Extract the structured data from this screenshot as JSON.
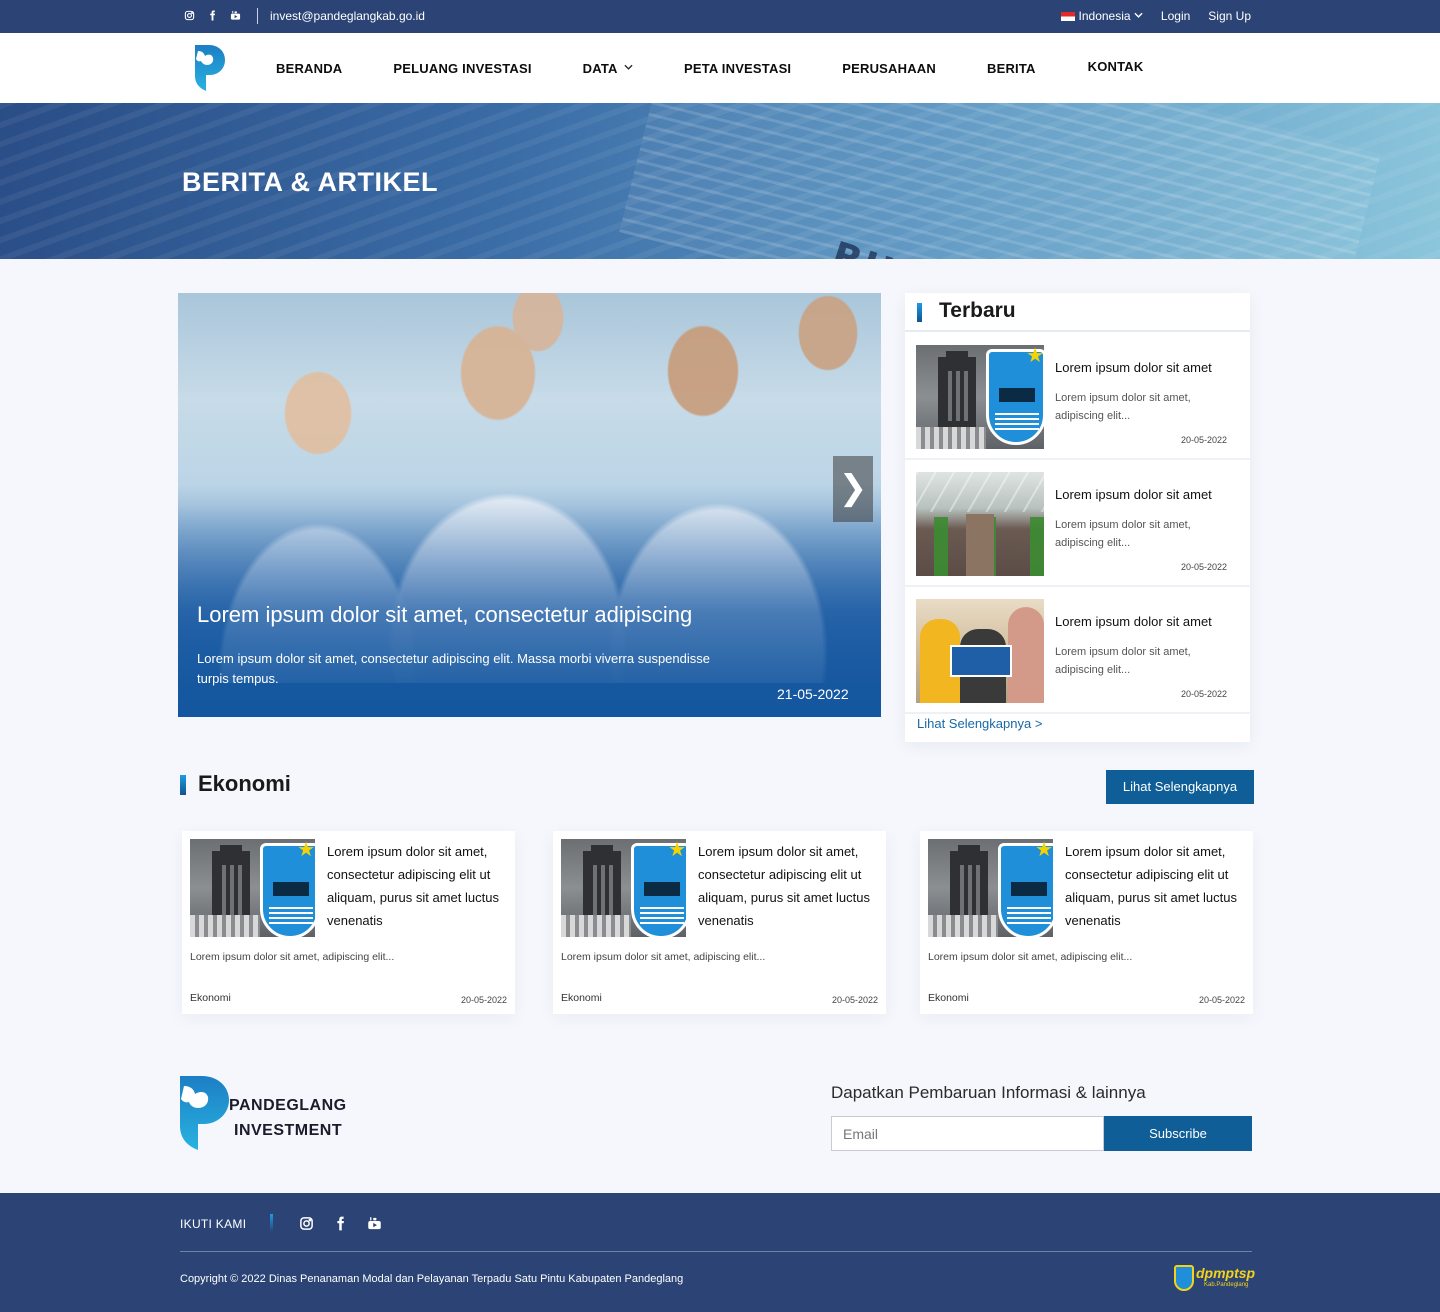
{
  "topbar": {
    "social_icons": [
      "instagram-icon",
      "facebook-icon",
      "youtube-icon"
    ],
    "email": "invest@pandeglangkab.go.id",
    "language": "Indonesia",
    "login": "Login",
    "signup": "Sign Up"
  },
  "nav": {
    "items": [
      "BERANDA",
      "PELUANG INVESTASI",
      "DATA",
      "PETA INVESTASI",
      "PERUSAHAAN",
      "BERITA",
      "KONTAK"
    ]
  },
  "hero": {
    "title": "BERITA & ARTIKEL",
    "background_text": "BUSINESS"
  },
  "featured": {
    "title": "Lorem ipsum dolor sit amet, consectetur adipiscing",
    "description": "Lorem ipsum dolor sit amet, consectetur adipiscing elit. Massa morbi viverra suspendisse turpis tempus.",
    "date": "21-05-2022",
    "next_glyph": "❯"
  },
  "latest": {
    "heading": "Terbaru",
    "items": [
      {
        "title": "Lorem ipsum dolor sit amet",
        "excerpt": "Lorem ipsum dolor sit amet, adipiscing elit...",
        "date": "20-05-2022"
      },
      {
        "title": "Lorem ipsum dolor sit amet",
        "excerpt": "Lorem ipsum dolor sit amet, adipiscing elit...",
        "date": "20-05-2022"
      },
      {
        "title": "Lorem ipsum dolor sit amet",
        "excerpt": "Lorem ipsum dolor sit amet, adipiscing elit...",
        "date": "20-05-2022"
      }
    ],
    "more_link": "Lihat Selengkapnya >"
  },
  "ekonomi": {
    "heading": "Ekonomi",
    "more_button": "Lihat Selengkapnya",
    "cards": [
      {
        "title": "Lorem ipsum dolor sit amet, consectetur adipiscing elit ut aliquam, purus sit amet luctus venenatis",
        "excerpt": "Lorem ipsum dolor sit amet, adipiscing elit...",
        "category": "Ekonomi",
        "date": "20-05-2022"
      },
      {
        "title": "Lorem ipsum dolor sit amet, consectetur adipiscing elit ut aliquam, purus sit amet luctus venenatis",
        "excerpt": "Lorem ipsum dolor sit amet, adipiscing elit...",
        "category": "Ekonomi",
        "date": "20-05-2022"
      },
      {
        "title": "Lorem ipsum dolor sit amet, consectetur adipiscing elit ut aliquam, purus sit amet luctus venenatis",
        "excerpt": "Lorem ipsum dolor sit amet, adipiscing elit...",
        "category": "Ekonomi",
        "date": "20-05-2022"
      }
    ]
  },
  "brand": {
    "line1": "PANDEGLANG",
    "line2": "INVESTMENT"
  },
  "subscribe": {
    "title": "Dapatkan Pembaruan Informasi & lainnya",
    "placeholder": "Email",
    "button": "Subscribe"
  },
  "footer": {
    "follow_label": "IKUTI KAMI",
    "copyright": "Copyright © 2022 Dinas Penanaman Modal dan Pelayanan Terpadu Satu Pintu Kabupaten Pandeglang",
    "partner_logo": "dpmptsp",
    "partner_sub": "Kab.Pandeglang"
  },
  "colors": {
    "navy": "#2b4475",
    "primary_button": "#0f5e98",
    "accent_bar": "#1d9be3",
    "link": "#1669a8"
  }
}
